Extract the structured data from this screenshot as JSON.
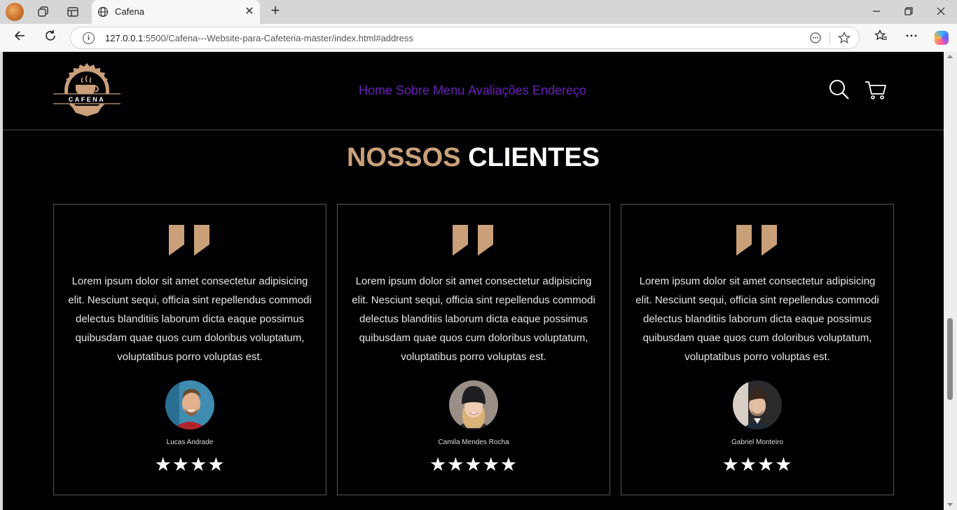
{
  "browser": {
    "tab_title": "Cafena",
    "url_host": "127.0.0.1",
    "url_rest": ":5500/Cafena---Website-para-Cafeteria-master/index.html#address",
    "close_symbol": "✕",
    "new_tab_symbol": "+"
  },
  "logo": {
    "text": "CAFENA"
  },
  "nav": {
    "items": [
      "Home",
      "Sobre",
      "Menu",
      "Avaliações",
      "Endereço"
    ]
  },
  "section": {
    "title_accent": "NOSSOS",
    "title_main": "CLIENTES"
  },
  "testimonials": [
    {
      "text": "Lorem ipsum dolor sit amet consectetur adipisicing elit. Nesciunt sequi, officia sint repellendus commodi delectus blanditiis laborum dicta eaque possimus quibusdam quae quos cum doloribus voluptatum, voluptatibus porro voluptas est.",
      "name": "Lucas Andrade",
      "stars": "★★★★"
    },
    {
      "text": "Lorem ipsum dolor sit amet consectetur adipisicing elit. Nesciunt sequi, officia sint repellendus commodi delectus blanditiis laborum dicta eaque possimus quibusdam quae quos cum doloribus voluptatum, voluptatibus porro voluptas est.",
      "name": "Camila Mendes Rocha",
      "stars": "★★★★★"
    },
    {
      "text": "Lorem ipsum dolor sit amet consectetur adipisicing elit. Nesciunt sequi, officia sint repellendus commodi delectus blanditiis laborum dicta eaque possimus quibusdam quae quos cum doloribus voluptatum, voluptatibus porro voluptas est.",
      "name": "Gabriel Monteiro",
      "stars": "★★★★"
    }
  ],
  "colors": {
    "accent": "#c9a07a",
    "nav": "#6a1fb8",
    "background": "#010103"
  },
  "icons": [
    "search-icon",
    "cart-icon",
    "quote-icon",
    "star-icon"
  ]
}
